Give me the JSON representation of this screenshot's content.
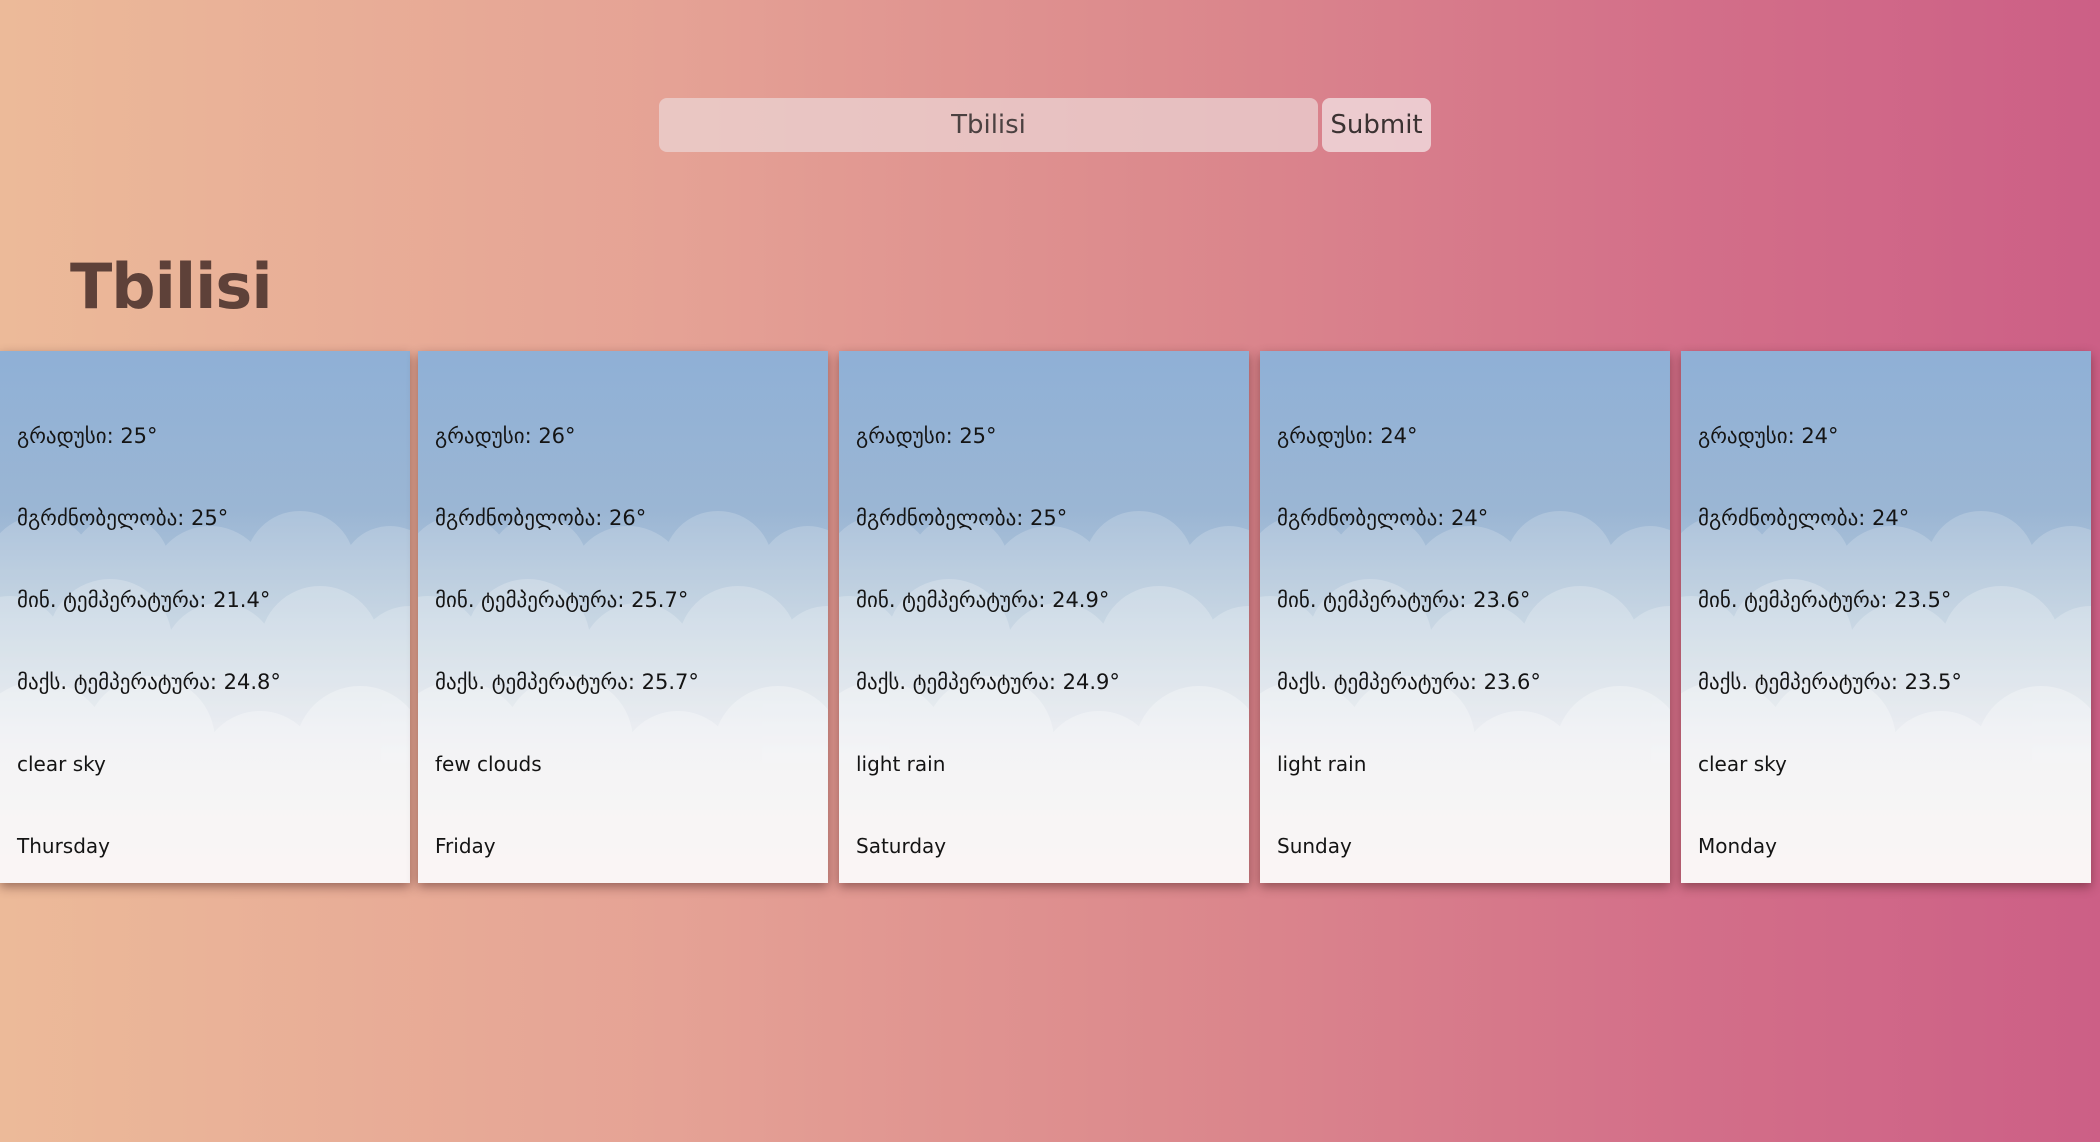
{
  "search": {
    "value": "Tbilisi",
    "submit_label": "Submit"
  },
  "city": "Tbilisi",
  "forecast": [
    {
      "temp": "გრადუსი: 25°",
      "feels_like": "მგრძნობელობა: 25°",
      "temp_min": "მინ. ტემპერატურა: 21.4°",
      "temp_max": "მაქს. ტემპერატურა: 24.8°",
      "description": "clear sky",
      "day": "Thursday"
    },
    {
      "temp": "გრადუსი: 26°",
      "feels_like": "მგრძნობელობა: 26°",
      "temp_min": "მინ. ტემპერატურა: 25.7°",
      "temp_max": "მაქს. ტემპერატურა: 25.7°",
      "description": "few clouds",
      "day": "Friday"
    },
    {
      "temp": "გრადუსი: 25°",
      "feels_like": "მგრძნობელობა: 25°",
      "temp_min": "მინ. ტემპერატურა: 24.9°",
      "temp_max": "მაქს. ტემპერატურა: 24.9°",
      "description": "light rain",
      "day": "Saturday"
    },
    {
      "temp": "გრადუსი: 24°",
      "feels_like": "მგრძნობელობა: 24°",
      "temp_min": "მინ. ტემპერატურა: 23.6°",
      "temp_max": "მაქს. ტემპერატურა: 23.6°",
      "description": "light rain",
      "day": "Sunday"
    },
    {
      "temp": "გრადუსი: 24°",
      "feels_like": "მგრძნობელობა: 24°",
      "temp_min": "მინ. ტემპერატურა: 23.5°",
      "temp_max": "მაქს. ტემპერატურა: 23.5°",
      "description": "clear sky",
      "day": "Monday"
    }
  ]
}
